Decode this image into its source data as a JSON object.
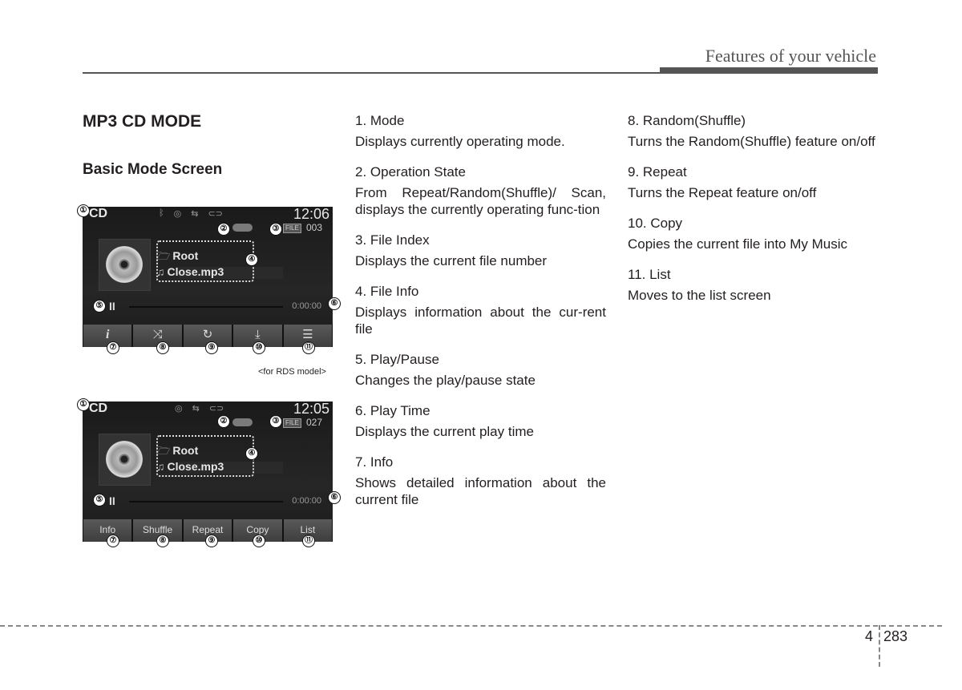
{
  "header": {
    "title": "Features of your vehicle"
  },
  "section": {
    "title": "MP3 CD MODE",
    "subtitle": "Basic Mode Screen"
  },
  "screens": [
    {
      "mode": "CD",
      "clock": "12:06",
      "status_icons": [
        "bluetooth-icon",
        "disc-icon",
        "usb-icon",
        "aux-icon"
      ],
      "status_glyphs": [
        "ᛒ",
        "◎",
        "⇆",
        "⊂⊃"
      ],
      "file_badge": "FILE",
      "file_number": "003",
      "folder": "Root",
      "filename": "Close.mp3",
      "play_state_glyph": "II",
      "play_time": "0:00:00",
      "buttons": [
        {
          "name": "info",
          "label": "i"
        },
        {
          "name": "shuffle",
          "label": "⤨"
        },
        {
          "name": "repeat",
          "label": "↻"
        },
        {
          "name": "copy",
          "label": "⤓"
        },
        {
          "name": "list",
          "label": "☰"
        }
      ],
      "caption": "<for RDS model>"
    },
    {
      "mode": "CD",
      "clock": "12:05",
      "status_icons": [
        "disc-icon",
        "usb-icon",
        "aux-icon"
      ],
      "status_glyphs": [
        "◎",
        "⇆",
        "⊂⊃"
      ],
      "file_badge": "FILE",
      "file_number": "027",
      "folder": "Root",
      "filename": "Close.mp3",
      "play_state_glyph": "II",
      "play_time": "0:00:00",
      "buttons": [
        {
          "name": "info",
          "label": "Info"
        },
        {
          "name": "shuffle",
          "label": "Shuffle"
        },
        {
          "name": "repeat",
          "label": "Repeat"
        },
        {
          "name": "copy",
          "label": "Copy"
        },
        {
          "name": "list",
          "label": "List"
        }
      ]
    }
  ],
  "callouts": [
    "①",
    "②",
    "③",
    "④",
    "⑤",
    "⑥",
    "⑦",
    "⑧",
    "⑨",
    "⑩",
    "⑪"
  ],
  "entries": [
    {
      "title": "1. Mode",
      "desc": "Displays currently operating mode."
    },
    {
      "title": "2. Operation State",
      "desc": "From Repeat/Random(Shuffle)/ Scan, displays the currently operating func-tion"
    },
    {
      "title": "3. File Index",
      "desc": "Displays the current file number"
    },
    {
      "title": "4. File Info",
      "desc": "Displays information about the cur-rent file"
    },
    {
      "title": "5. Play/Pause",
      "desc": "Changes the play/pause state"
    },
    {
      "title": "6. Play Time",
      "desc": "Displays the current play time"
    },
    {
      "title": "7. Info",
      "desc": "Shows detailed information about the current file"
    },
    {
      "title": "8. Random(Shuffle)",
      "desc": "Turns the Random(Shuffle) feature on/off"
    },
    {
      "title": "9. Repeat",
      "desc": "Turns the Repeat feature on/off"
    },
    {
      "title": "10. Copy",
      "desc": "Copies the current file into My Music"
    },
    {
      "title": "11. List",
      "desc": "Moves to the list screen"
    }
  ],
  "footer": {
    "chapter": "4",
    "page": "283"
  }
}
